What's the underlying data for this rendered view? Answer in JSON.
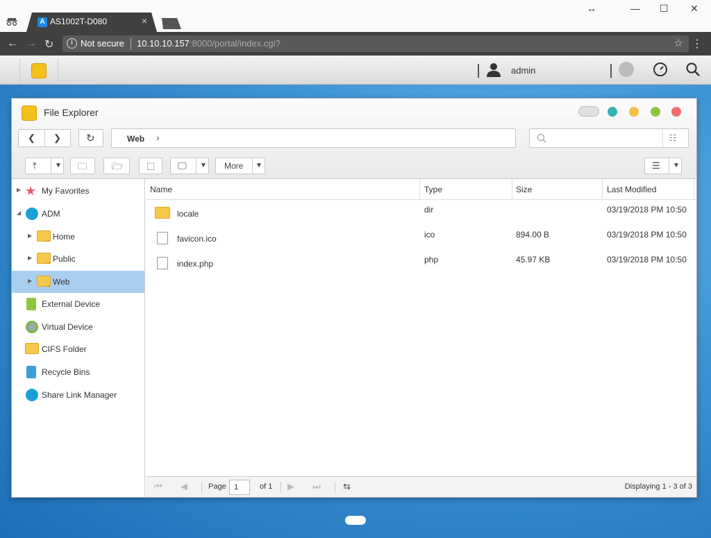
{
  "browser": {
    "tab_title": "AS1002T-D080",
    "tab_close": "×",
    "security_label": "Not secure",
    "url_host": "10.10.10.157",
    "url_rest": ":8000/portal/index.cgi?",
    "resize_glyph": "↔",
    "minimize": "—",
    "maximize": "☐",
    "close": "✕"
  },
  "adm": {
    "username": "admin"
  },
  "window": {
    "title": "File Explorer",
    "breadcrumb": [
      "Web",
      "›"
    ],
    "toolbar_more": "More",
    "control_colors": [
      "#34b2b6",
      "#f5bf42",
      "#8cc63f",
      "#ee6c6c"
    ]
  },
  "sidebar": {
    "items": [
      {
        "label": "My Favorites"
      },
      {
        "label": "ADM"
      },
      {
        "label": "Home"
      },
      {
        "label": "Public"
      },
      {
        "label": "Web"
      },
      {
        "label": "External Device"
      },
      {
        "label": "Virtual Device"
      },
      {
        "label": "CIFS Folder"
      },
      {
        "label": "Recycle Bins"
      },
      {
        "label": "Share Link Manager"
      }
    ]
  },
  "grid": {
    "columns": [
      "Name",
      "Type",
      "Size",
      "Last Modified"
    ],
    "rows": [
      {
        "name": "locale",
        "type": "dir",
        "size": "",
        "modified": "03/19/2018 PM 10:50",
        "icon": "folder-icon"
      },
      {
        "name": "favicon.ico",
        "type": "ico",
        "size": "894.00 B",
        "modified": "03/19/2018 PM 10:50",
        "icon": "image-file-icon"
      },
      {
        "name": "index.php",
        "type": "php",
        "size": "45.97 KB",
        "modified": "03/19/2018 PM 10:50",
        "icon": "code-file-icon"
      }
    ]
  },
  "pager": {
    "page_label": "Page",
    "page_value": "1",
    "of_label": "of 1",
    "display_text": "Displaying 1 - 3 of 3"
  }
}
